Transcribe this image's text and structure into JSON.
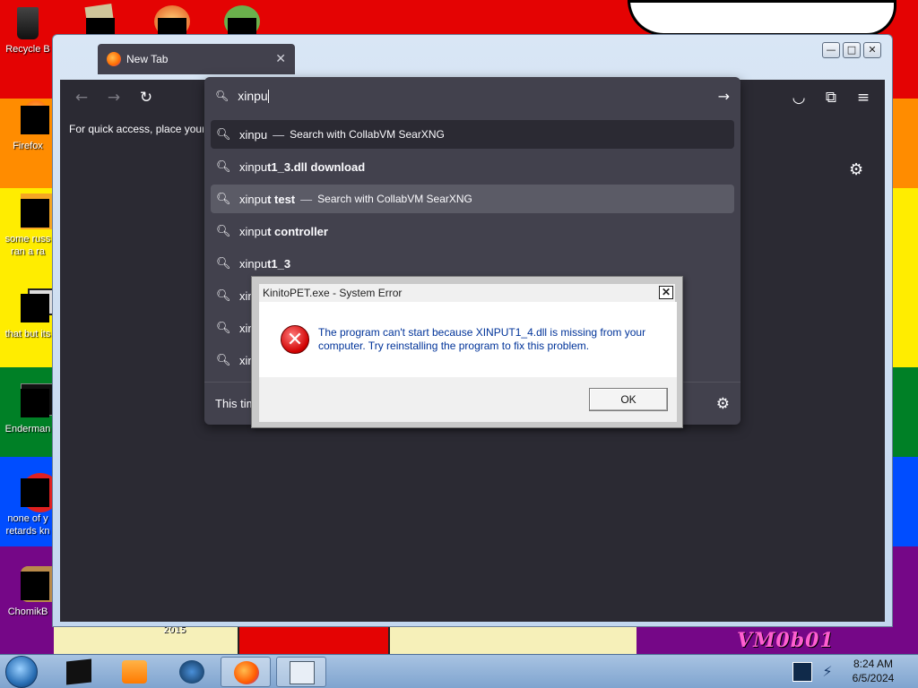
{
  "desktop": {
    "icons": [
      {
        "label": "Recycle B",
        "icon": "recycle-bin-icon"
      },
      {
        "label": "Firefox",
        "icon": "firefox-icon"
      },
      {
        "label": "some russ\nran a ra",
        "icon": "russian-icon"
      },
      {
        "label": "that but its",
        "icon": "folder-icon"
      },
      {
        "label": "Enderman",
        "icon": "window-icon"
      },
      {
        "label": "none of y\nretards kn",
        "icon": "opera-icon"
      },
      {
        "label": "ChomikB",
        "icon": "hamster-icon"
      }
    ],
    "watermark_year": "2015",
    "watermark_text": "VM0b01"
  },
  "browser": {
    "tab_title": "New Tab",
    "tab_close": "✕",
    "bookmark_hint": "For quick access, place your b",
    "urlbar": {
      "query": "xinpu",
      "suggestions": [
        {
          "typed": "xinpu",
          "completion": "",
          "separator": "—",
          "action": "Search with CollabVM SearXNG"
        },
        {
          "typed": "xinpu",
          "completion": "t1_3.dll download",
          "separator": "",
          "action": ""
        },
        {
          "typed": "xinpu",
          "completion": "t test",
          "separator": "—",
          "action": "Search with CollabVM SearXNG"
        },
        {
          "typed": "xinpu",
          "completion": "t controller",
          "separator": "",
          "action": ""
        },
        {
          "typed": "xinpu",
          "completion": "t1_3",
          "separator": "",
          "action": ""
        },
        {
          "typed": "xin",
          "completion": "",
          "separator": "",
          "action": ""
        },
        {
          "typed": "xin",
          "completion": "",
          "separator": "",
          "action": ""
        },
        {
          "typed": "xin",
          "completion": "",
          "separator": "",
          "action": ""
        }
      ],
      "footer_text": "This tim"
    },
    "window_buttons": {
      "minimize": "—",
      "maximize": "□",
      "close": "✕"
    }
  },
  "error_dialog": {
    "title": "KinitoPET.exe - System Error",
    "close": "✕",
    "message": "The program can't start because XINPUT1_4.dll is missing from your computer. Try reinstalling the program to fix this problem.",
    "ok_label": "OK",
    "icon": "error-x-icon"
  },
  "taskbar": {
    "time": "8:24 AM",
    "date": "6/5/2024"
  },
  "colors": {
    "browser_bg": "#2b2a33",
    "popup_bg": "#42414d",
    "selected_row": "#5b5b66"
  }
}
